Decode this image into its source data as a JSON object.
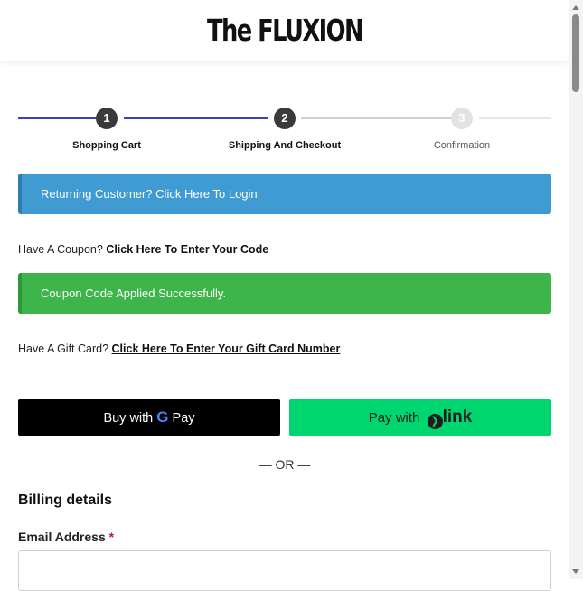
{
  "brand": {
    "logo": "The FLUXION"
  },
  "stepper": {
    "steps": [
      {
        "number": "1",
        "label": "Shopping Cart"
      },
      {
        "number": "2",
        "label": "Shipping And Checkout"
      },
      {
        "number": "3",
        "label": "Confirmation"
      }
    ],
    "colors": {
      "done": "#3d3dc6",
      "active_circle": "#3a3a3a",
      "inactive": "#e2e2e2"
    }
  },
  "login_banner": {
    "text": "Returning Customer? Click Here To Login",
    "color": "#3f9bd1"
  },
  "coupon": {
    "prefix": "Have A Coupon? ",
    "link": "Click Here To Enter Your Code"
  },
  "coupon_success": {
    "text": "Coupon Code Applied Successfully.",
    "color": "#3db54a"
  },
  "gift_card": {
    "prefix": "Have A Gift Card? ",
    "link": "Click Here To Enter Your Gift Card Number"
  },
  "payments": {
    "gpay_prefix": "Buy with ",
    "gpay_brand": "Pay",
    "link_prefix": "Pay with ",
    "link_brand": "link"
  },
  "divider": "— OR —",
  "billing": {
    "title": "Billing details",
    "email_label": "Email Address",
    "required_mark": "*",
    "email_value": ""
  }
}
